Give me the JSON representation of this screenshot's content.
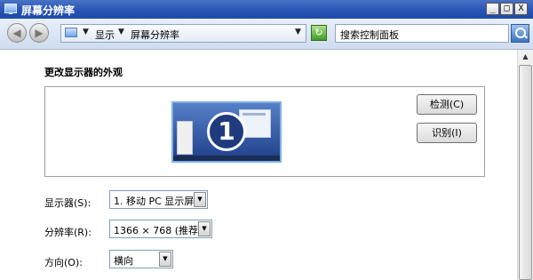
{
  "window": {
    "title": "屏幕分辨率",
    "minimize": "_",
    "maximize": "□",
    "close": "X"
  },
  "nav": {
    "back": "◀",
    "forward": "▶"
  },
  "address": {
    "arrow": "▼",
    "crumbs": [
      "显示",
      "屏幕分辨率"
    ],
    "dropdown": "▼",
    "refresh": "↻"
  },
  "search": {
    "placeholder": "搜索控制面板"
  },
  "main": {
    "heading": "更改显示器的外观",
    "monitor_number": "1",
    "detect_label": "检测(C)",
    "identify_label": "识别(I)",
    "display_label": "显示器(S):",
    "display_value": "1. 移动 PC 显示屏",
    "resolution_label": "分辨率(R):",
    "resolution_value": "1366 × 768 (推荐)",
    "orientation_label": "方向(O):",
    "orientation_value": "横向",
    "dropdown_glyph": "▼"
  },
  "scroll": {
    "up_glyph": "▲"
  }
}
